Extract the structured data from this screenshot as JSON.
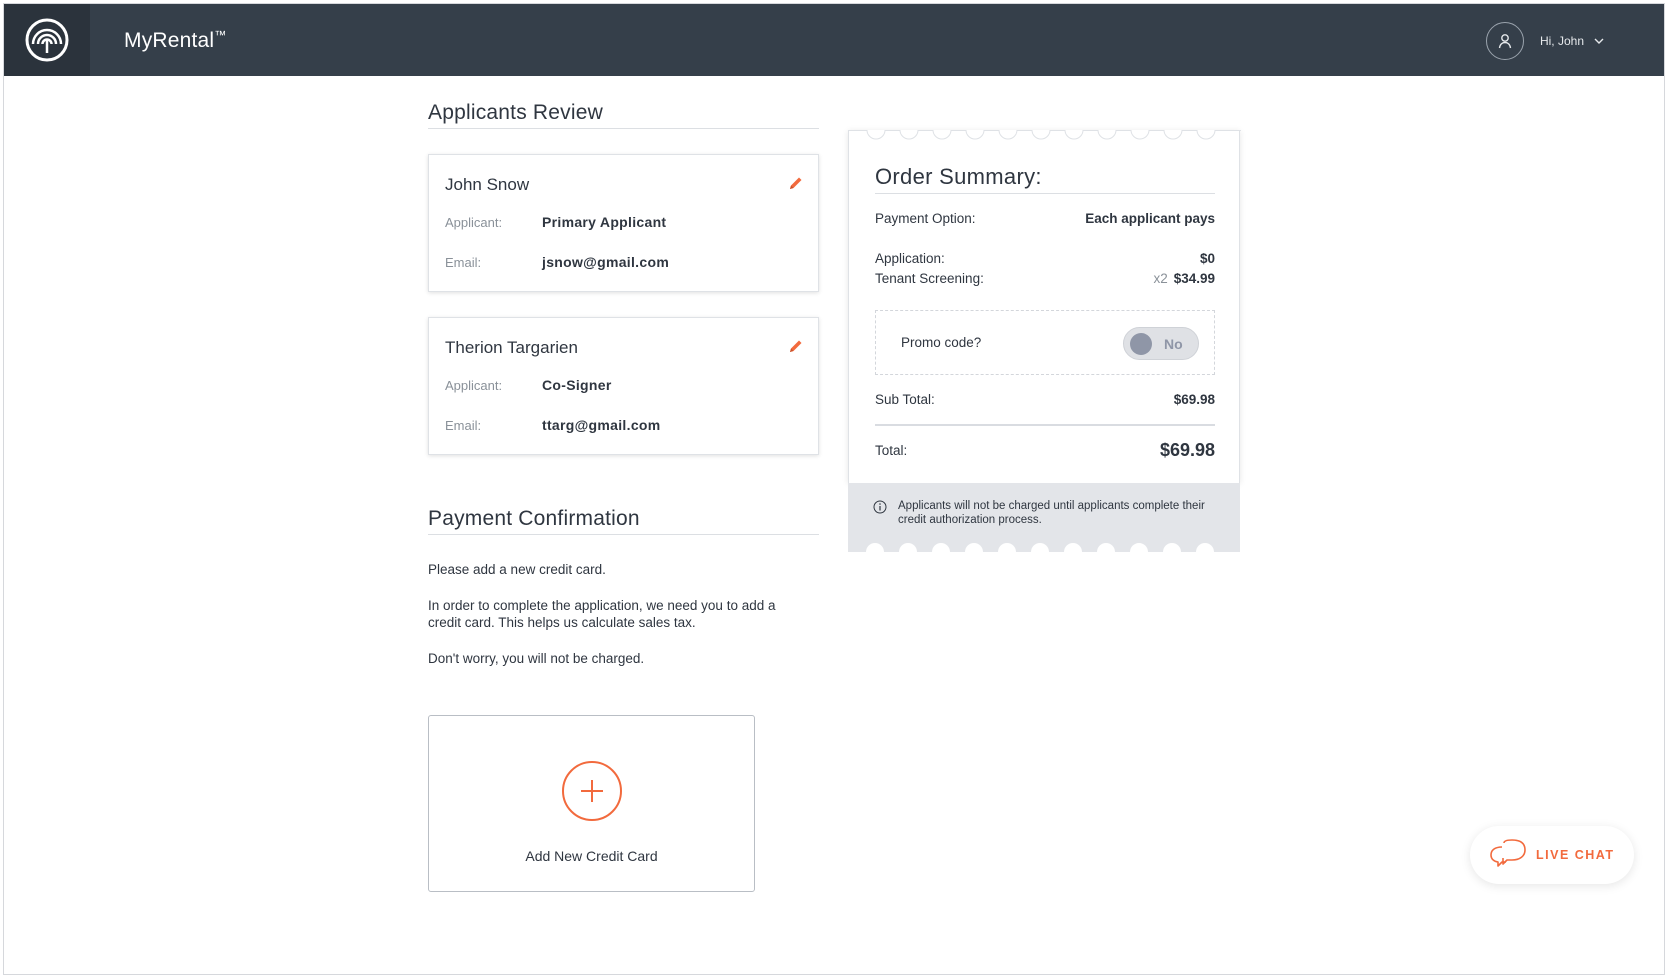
{
  "header": {
    "app_name": "MyRental",
    "trademark": "™",
    "greeting": "Hi, John"
  },
  "applicants_review": {
    "title": "Applicants Review",
    "applicants": [
      {
        "name": "John Snow",
        "applicant_label": "Applicant:",
        "applicant_value": "Primary Applicant",
        "email_label": "Email:",
        "email_value": "jsnow@gmail.com"
      },
      {
        "name": "Therion Targarien",
        "applicant_label": "Applicant:",
        "applicant_value": "Co-Signer",
        "email_label": "Email:",
        "email_value": "ttarg@gmail.com"
      }
    ]
  },
  "payment_confirmation": {
    "title": "Payment Confirmation",
    "paragraphs": [
      "Please add a new credit card.",
      "In order to complete the application, we need you to add a credit card. This helps us calculate sales tax.",
      "Don't worry, you will not be charged."
    ],
    "add_card_label": "Add New Credit Card"
  },
  "order_summary": {
    "title": "Order Summary:",
    "payment_option_label": "Payment Option:",
    "payment_option_value": "Each applicant pays",
    "application_label": "Application:",
    "application_value": "$0",
    "screening_label": "Tenant Screening:",
    "screening_multiplier": "x2",
    "screening_value": "$34.99",
    "promo_label": "Promo code?",
    "promo_toggle": "No",
    "subtotal_label": "Sub Total:",
    "subtotal_value": "$69.98",
    "total_label": "Total:",
    "total_value": "$69.98",
    "note": "Applicants will not be charged until applicants complete their credit authorization process."
  },
  "live_chat": {
    "label": "LIVE CHAT"
  },
  "colors": {
    "header_bg": "#353f4a",
    "logo_bg": "#2b333c",
    "accent": "#f26a3d",
    "toggle_knob": "#8f96a7"
  }
}
